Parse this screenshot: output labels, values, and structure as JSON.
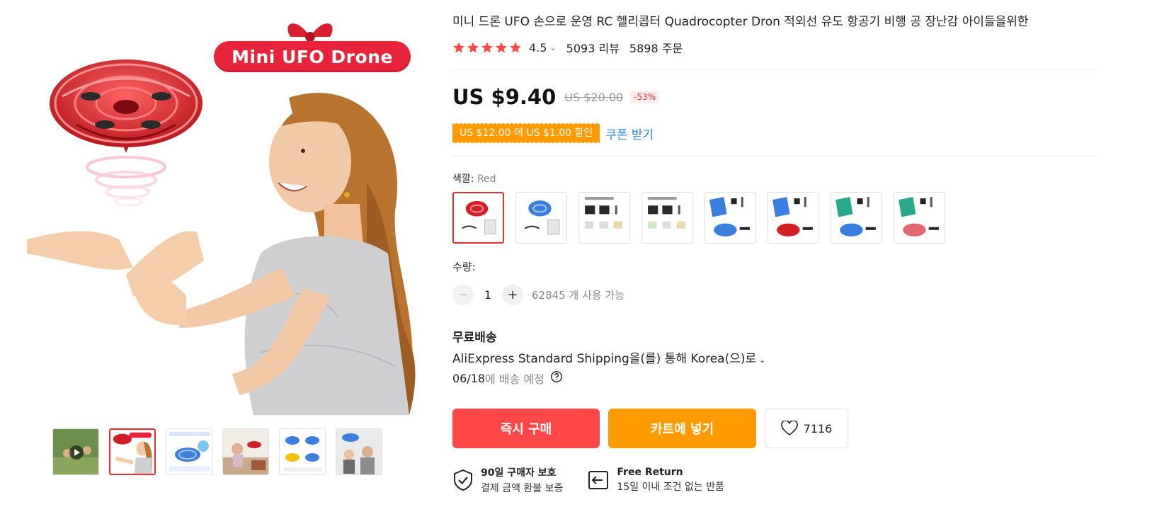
{
  "gallery": {
    "banner_text": "Mini UFO Drone",
    "thumbnails": [
      {
        "name": "video-thumb",
        "has_play": true
      },
      {
        "name": "girl-drone-thumb",
        "active": true
      },
      {
        "name": "drone-blue-thumb"
      },
      {
        "name": "room-thumb"
      },
      {
        "name": "diagram-thumb"
      },
      {
        "name": "family-thumb"
      }
    ]
  },
  "product": {
    "title": "미니 드론 UFO 손으로 운영 RC 헬리콥터 Quadrocopter Dron 적외선 유도 항공기 비행 공 장난감 아이들을위한",
    "rating": "4.5",
    "reviews": "5093 리뷰",
    "orders": "5898 주문",
    "price": "US $9.40",
    "original_price": "US $20.00",
    "discount": "-53%",
    "coupon_text": "US $12.00 에 US $1.00 할인",
    "coupon_link": "쿠폰 받기",
    "color_label": "색깔:",
    "color_value": "Red",
    "quantity_label": "수량:",
    "quantity_value": "1",
    "quantity_minus": "−",
    "quantity_plus": "+",
    "stock": "62845 개 사용 가능",
    "shipping_title": "무료배송",
    "shipping_method": "AliExpress Standard Shipping을(를) 통해 Korea(으)로",
    "delivery_date": "06/18",
    "delivery_text": "에 배송 예정",
    "buy_now": "즉시 구매",
    "add_to_cart": "카트에 넣기",
    "wishlist_count": "7116",
    "guarantee1_title": "90일 구매자 보호",
    "guarantee1_sub": "결제 금액 환불 보증",
    "guarantee2_title": "Free Return",
    "guarantee2_sub": "15일 이내 조건 없는 반품"
  },
  "colors": {
    "accent_red": "#ff4747",
    "accent_orange": "#ff9a00",
    "link_blue": "#2a83e8",
    "star": "#ff4747"
  }
}
